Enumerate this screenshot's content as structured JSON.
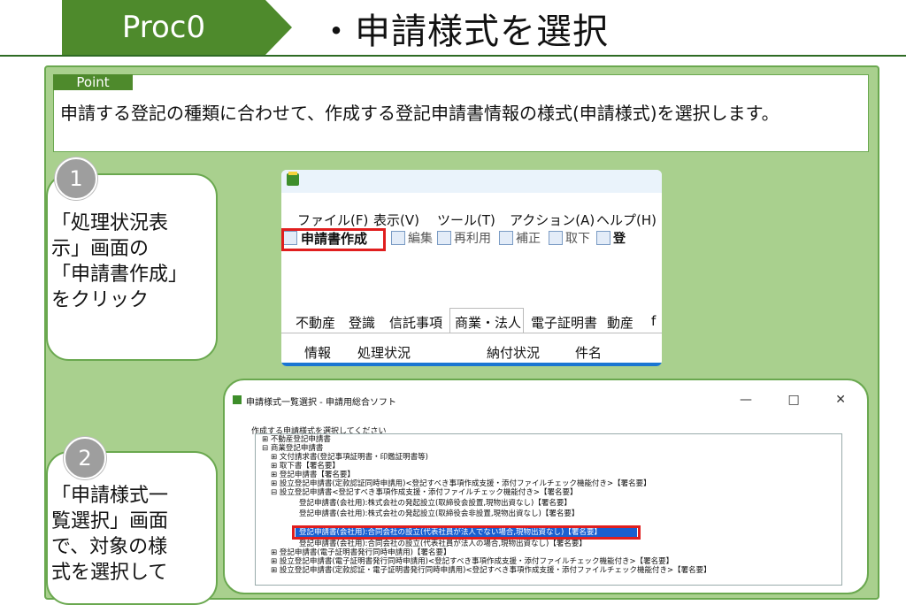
{
  "header": {
    "proc_label": "Proc0",
    "title": "・申請様式を選択"
  },
  "point": {
    "tag": "Point",
    "text": "申請する登記の種類に合わせて、作成する登記申請書情報の様式(申請様式)を選択します。"
  },
  "steps": [
    {
      "number": "1",
      "lines": [
        "「処理状況表",
        "示」画面の",
        "「申請書作成」",
        "をクリック"
      ]
    },
    {
      "number": "2",
      "lines": [
        "「申請様式一",
        "覧選択」画面",
        "で、対象の様",
        "式を選択して"
      ]
    }
  ],
  "screenshot1": {
    "menus": [
      "ファイル(F)",
      "表示(V)",
      "ツール(T)",
      "アクション(A)",
      "ヘルプ(H)"
    ],
    "toolbar": [
      "申請書作成",
      "編集",
      "再利用",
      "補正",
      "取下",
      "登"
    ],
    "tabs": [
      "不動産",
      "登識",
      "信託事項",
      "商業・法人",
      "電子証明書",
      "動産",
      "f"
    ],
    "columns": [
      "情報",
      "処理状況",
      "納付状況",
      "件名"
    ]
  },
  "screenshot2": {
    "title": "申請様式一覧選択 - 申請用総合ソフト",
    "window_controls": [
      "—",
      "□",
      "✕"
    ],
    "prompt": "作成する申請様式を選択してください",
    "tree": [
      "⊞ 不動産登記申請書",
      "⊟ 商業登記申請書",
      "⊞ 文付請求書(登記事項証明書・印鑑証明書等)",
      "⊞ 取下書【署名要】",
      "⊞ 登記申請書【署名要】",
      "⊞ 設立登記申請書(定款認証同時申請用)<登記すべき事項作成支援・添付ファイルチェック機能付き>【署名要】",
      "⊟ 設立登記申請書<登記すべき事項作成支援・添付ファイルチェック機能付き>【署名要】",
      "登記申請書(会社用):株式会社の発起設立(取締役会設置,現物出資なし)【署名要】",
      "登記申請書(会社用):株式会社の発起設立(取締役会非設置,現物出資なし)【署名要】",
      "登記申請書(会社用):合同会社の設立(代表社員が法人でない場合,現物出資なし)【署名要】",
      "登記申請書(会社用):合同会社の設立(代表社員が法人の場合,現物出資なし)【署名要】",
      "⊞ 登記申請書(電子証明書発行同時申請用)【署名要】",
      "⊞ 設立登記申請書(電子証明書発行同時申請用)<登記すべき事項作成支援・添付ファイルチェック機能付き>【署名要】",
      "⊞ 設立登記申請書(定款認証・電子証明書発行同時申請用)<登記すべき事項作成支援・添付ファイルチェック機能付き>【署名要】"
    ],
    "selected_index": 9
  },
  "colors": {
    "accent_green": "#4e8a2c",
    "panel_green": "#a9d08e",
    "highlight_red": "#e01e1e",
    "select_blue": "#1a5fd0"
  }
}
